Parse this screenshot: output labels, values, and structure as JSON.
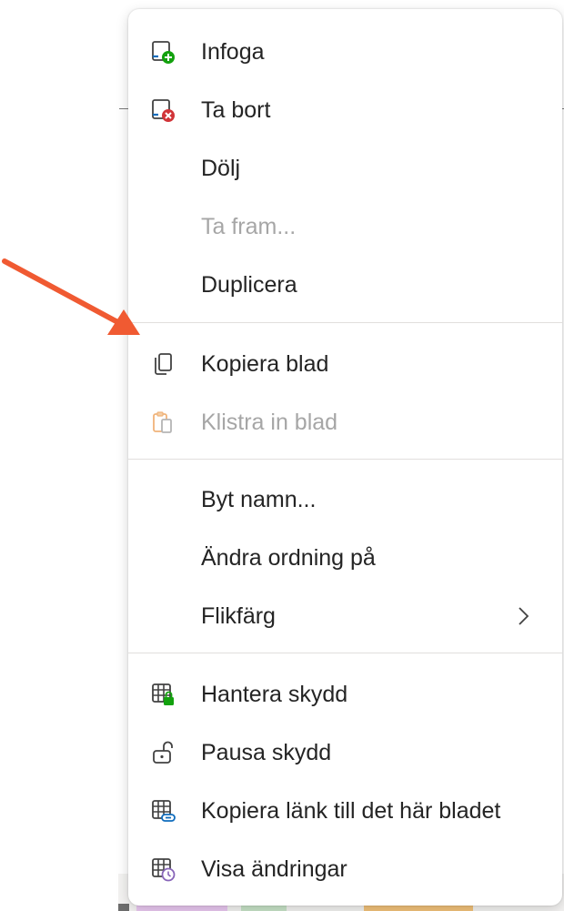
{
  "menu": {
    "items": [
      {
        "label": "Infoga",
        "icon": "insert-sheet-icon",
        "enabled": true
      },
      {
        "label": "Ta bort",
        "icon": "delete-sheet-icon",
        "enabled": true
      },
      {
        "label": "Dölj",
        "icon": "",
        "enabled": true
      },
      {
        "label": "Ta fram...",
        "icon": "",
        "enabled": false
      },
      {
        "label": "Duplicera",
        "icon": "",
        "enabled": true
      },
      {
        "label": "Kopiera blad",
        "icon": "copy-icon",
        "enabled": true
      },
      {
        "label": "Klistra in blad",
        "icon": "paste-icon",
        "enabled": false
      },
      {
        "label": "Byt namn...",
        "icon": "",
        "enabled": true
      },
      {
        "label": "Ändra ordning på",
        "icon": "",
        "enabled": true
      },
      {
        "label": "Flikfärg",
        "icon": "",
        "enabled": true,
        "submenu": true
      },
      {
        "label": "Hantera skydd",
        "icon": "table-lock-icon",
        "enabled": true
      },
      {
        "label": "Pausa skydd",
        "icon": "unlock-icon",
        "enabled": true
      },
      {
        "label": "Kopiera länk till det här bladet",
        "icon": "table-link-icon",
        "enabled": true
      },
      {
        "label": "Visa ändringar",
        "icon": "table-history-icon",
        "enabled": true
      }
    ]
  },
  "annotation": {
    "arrow_color": "#f05a32",
    "points_to": "Kopiera blad"
  },
  "colors": {
    "accent_green": "#13a10e",
    "delete_red": "#d13438",
    "blue": "#0f6cbd",
    "purple": "#8764b8",
    "paste_orange": "#f0b37a"
  }
}
